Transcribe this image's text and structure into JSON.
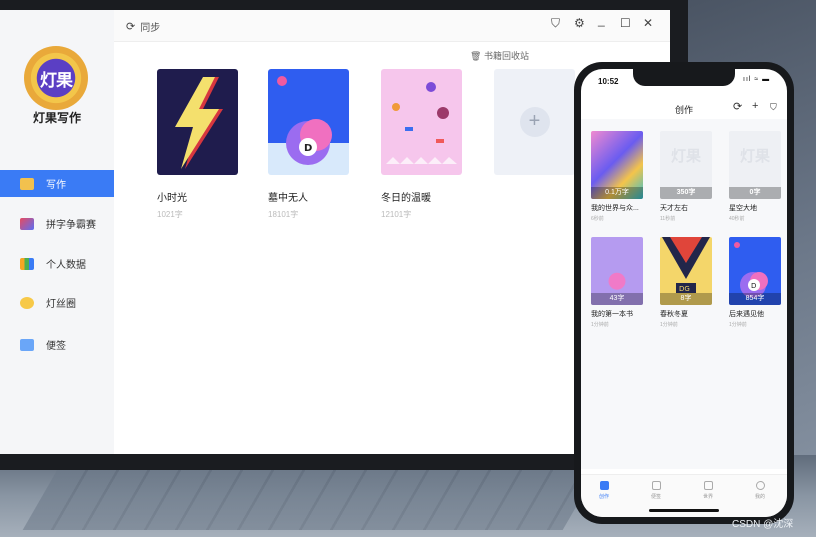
{
  "app": {
    "logo_text": "灯果",
    "name": "灯果写作"
  },
  "sidebar": {
    "items": [
      {
        "label": "写作",
        "icon": "pencil-icon"
      },
      {
        "label": "拼字争霸赛",
        "icon": "vs-icon"
      },
      {
        "label": "个人数据",
        "icon": "chart-icon"
      },
      {
        "label": "灯丝圈",
        "icon": "bulb-icon"
      },
      {
        "label": "便签",
        "icon": "note-icon"
      }
    ]
  },
  "topbar": {
    "sync_label": "同步",
    "controls": [
      "shirt-icon",
      "settings-icon",
      "minimize-icon",
      "maximize-icon",
      "close-icon"
    ]
  },
  "recycle": {
    "label": "书籍回收站"
  },
  "books": [
    {
      "title": "小时光",
      "meta": "1021字"
    },
    {
      "title": "墓中无人",
      "meta": "18101字"
    },
    {
      "title": "冬日的温暖",
      "meta": "12101字"
    }
  ],
  "add_book": {
    "icon": "plus-icon"
  },
  "phone": {
    "time": "10:52",
    "status": "ııl ≈ ▬",
    "header_title": "创作",
    "books": [
      {
        "title": "我的世界与众...",
        "count": "0.1万字",
        "sub": "6秒前"
      },
      {
        "title": "天才左右",
        "count": "350字",
        "sub": "11秒前",
        "ghost": "灯果"
      },
      {
        "title": "星空大地",
        "count": "0字",
        "sub": "40秒前",
        "ghost": "灯果"
      },
      {
        "title": "我的第一本书",
        "count": "43字",
        "sub": "1分钟前"
      },
      {
        "title": "春秋冬夏",
        "count": "8字",
        "sub": "1分钟前",
        "badge": "DG"
      },
      {
        "title": "后来遇见他",
        "count": "854字",
        "sub": "1分钟前",
        "badge": "D"
      }
    ],
    "tabs": [
      "创作",
      "便签",
      "世界",
      "我的"
    ]
  },
  "watermark": "CSDN @沈深",
  "colors": {
    "accent": "#3a7bf5"
  }
}
